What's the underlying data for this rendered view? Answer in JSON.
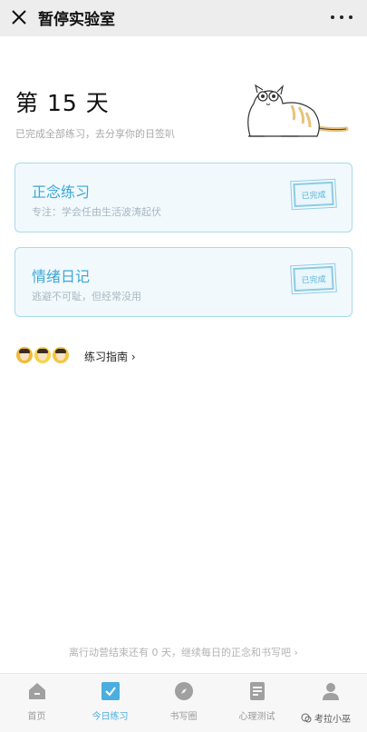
{
  "window": {
    "title": "暂停实验室"
  },
  "header": {
    "day_title": "第 15 天",
    "subtitle": "已完成全部练习，去分享你的日签叭"
  },
  "cards": [
    {
      "title": "正念练习",
      "subtitle": "专注：学会任由生活波涛起伏",
      "status": "已完成"
    },
    {
      "title": "情绪日记",
      "subtitle": "逃避不可耻，但经常没用",
      "status": "已完成"
    }
  ],
  "guide": {
    "label": "练习指南 ›"
  },
  "footer_note": "离行动营结束还有 0 天，继续每日的正念和书写吧 ›",
  "tabs": [
    {
      "label": "首页",
      "icon": "home-icon"
    },
    {
      "label": "今日练习",
      "icon": "check-square-icon"
    },
    {
      "label": "书写圈",
      "icon": "compass-icon"
    },
    {
      "label": "心理测试",
      "icon": "document-icon"
    },
    {
      "label": "",
      "icon": "person-icon"
    }
  ],
  "watermark": "考拉小巫",
  "colors": {
    "accent": "#3aa8d8",
    "card_bg": "#f1f9fd",
    "card_border": "#a9d9ee",
    "tab_active": "#4aaee0"
  }
}
